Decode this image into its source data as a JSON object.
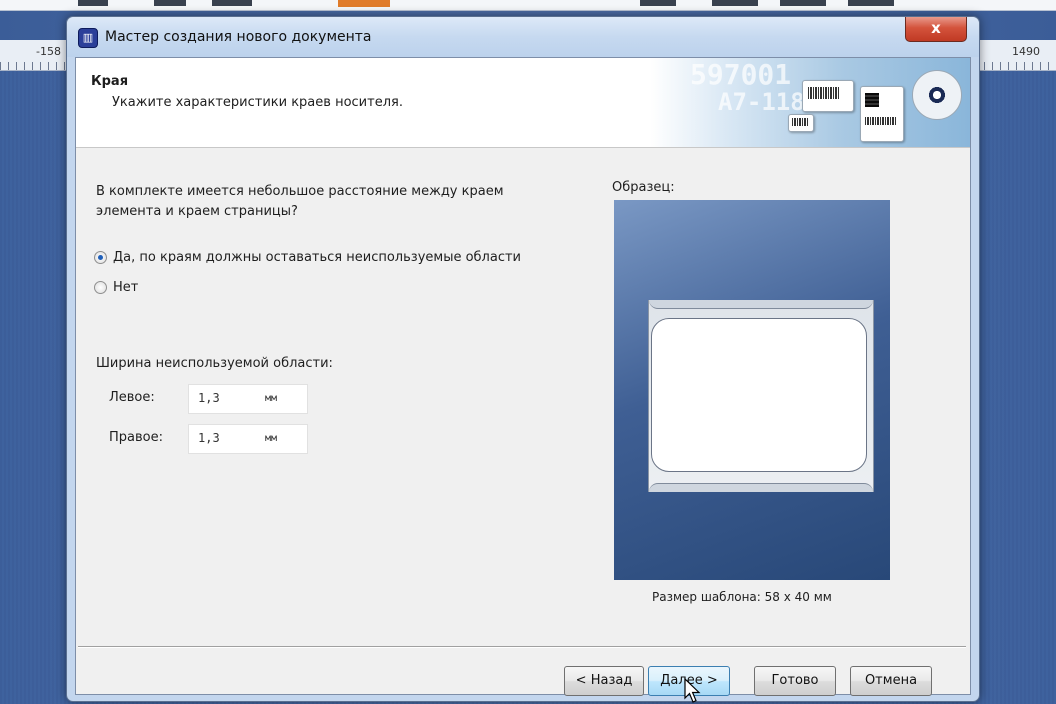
{
  "app": {
    "ruler_left_label": "-158",
    "ruler_right_label": "1490"
  },
  "dialog": {
    "title": "Мастер создания нового документа",
    "app_icon_glyph": "▥",
    "close_glyph": "x",
    "header": {
      "title": "Края",
      "subtitle": "Укажите характеристики краев носителя.",
      "banner_text_1": "597001",
      "banner_text_2": "A7-118"
    },
    "question": "В комплекте имеется небольшое расстояние между краем элемента и краем страницы?",
    "options": [
      {
        "label": "Да, по краям должны оставаться неиспользуемые области",
        "checked": true
      },
      {
        "label": "Нет",
        "checked": false
      }
    ],
    "width_section_title": "Ширина неиспользуемой области:",
    "fields": {
      "left": {
        "label": "Левое:",
        "value": "1,3",
        "unit": "мм"
      },
      "right": {
        "label": "Правое:",
        "value": "1,3",
        "unit": "мм"
      }
    },
    "sample": {
      "label": "Образец:",
      "size_text": "Размер шаблона:  58 x 40 мм"
    },
    "buttons": {
      "back": "< Назад",
      "next": "Далее >",
      "finish": "Готово",
      "cancel": "Отмена"
    }
  },
  "colors": {
    "accent": "#3c7fb1",
    "sample_bg": "#3f5f94",
    "close": "#c03a24"
  }
}
